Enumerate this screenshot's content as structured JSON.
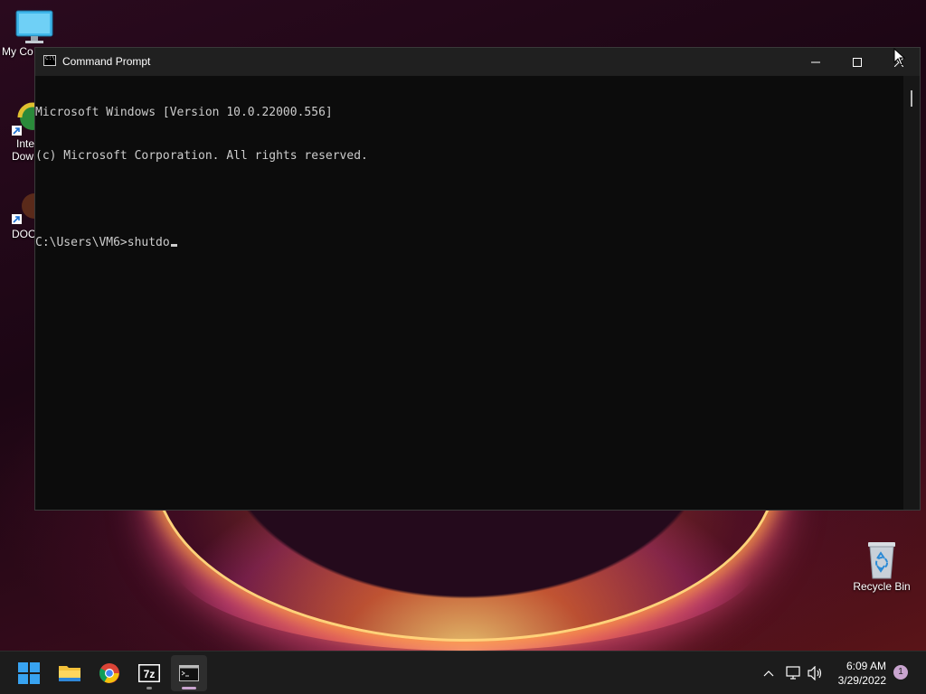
{
  "desktop": {
    "icons": [
      {
        "label": "My Co"
      },
      {
        "label_line1": "Inte",
        "label_line2": "Dow"
      },
      {
        "label": "DOO"
      },
      {
        "label": "Recycle Bin"
      }
    ]
  },
  "window": {
    "title": "Command Prompt",
    "icon": "cmd-icon",
    "controls": [
      "minimize",
      "maximize",
      "close"
    ]
  },
  "console": {
    "lines": [
      "Microsoft Windows [Version 10.0.22000.556]",
      "(c) Microsoft Corporation. All rights reserved.",
      "",
      "C:\\Users\\VM6>shutdo"
    ]
  },
  "taskbar": {
    "apps": [
      "start",
      "file-explorer",
      "chrome",
      "7zip",
      "command-prompt"
    ],
    "tray": {
      "time": "6:09 AM",
      "date": "3/29/2022",
      "notification_count": "1"
    }
  },
  "colors": {
    "console_bg": "#0c0c0c",
    "console_text": "#cccccc",
    "titlebar": "#202020",
    "taskbar": "#1c1c1c"
  }
}
